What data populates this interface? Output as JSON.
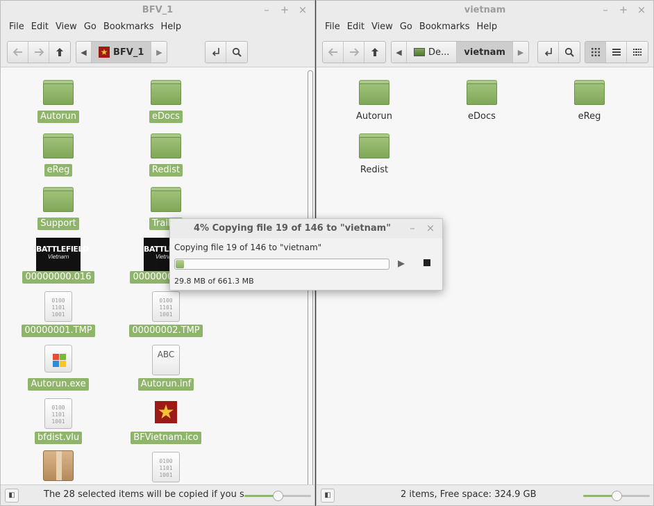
{
  "left_window": {
    "title": "BFV_1",
    "menu": [
      "File",
      "Edit",
      "View",
      "Go",
      "Bookmarks",
      "Help"
    ],
    "breadcrumb": [
      "BFV_1"
    ],
    "items": [
      {
        "name": "Autorun",
        "type": "folder"
      },
      {
        "name": "eDocs",
        "type": "folder"
      },
      {
        "name": "eReg",
        "type": "folder"
      },
      {
        "name": "Redist",
        "type": "folder"
      },
      {
        "name": "Support",
        "type": "folder"
      },
      {
        "name": "Trailer",
        "type": "folder"
      },
      {
        "name": "00000000.016",
        "type": "battlefield-image"
      },
      {
        "name": "00000001.016",
        "type": "battlefield-image"
      },
      {
        "name": "00000001.TMP",
        "type": "binary"
      },
      {
        "name": "00000002.TMP",
        "type": "binary"
      },
      {
        "name": "Autorun.exe",
        "type": "windows-exe"
      },
      {
        "name": "Autorun.inf",
        "type": "text"
      },
      {
        "name": "bfdist.vlu",
        "type": "binary"
      },
      {
        "name": "BFVietnam.ico",
        "type": "ico"
      },
      {
        "name": "",
        "type": "package"
      },
      {
        "name": "",
        "type": "binary"
      }
    ],
    "binary_glyph": [
      "0100",
      "1101",
      "1001"
    ],
    "text_glyph": "ABC",
    "bf_logo": {
      "main": "BATTLEFIELD",
      "sub": "Vietnam"
    },
    "status": "The 28 selected items will be copied if you s...",
    "zoom_level": 0.5
  },
  "right_window": {
    "title": "vietnam",
    "menu": [
      "File",
      "Edit",
      "View",
      "Go",
      "Bookmarks",
      "Help"
    ],
    "breadcrumb": [
      "De...",
      "vietnam"
    ],
    "items": [
      {
        "name": "Autorun",
        "type": "folder"
      },
      {
        "name": "eDocs",
        "type": "folder"
      },
      {
        "name": "eReg",
        "type": "folder"
      },
      {
        "name": "Redist",
        "type": "folder"
      }
    ],
    "status": "2 items, Free space: 324.9 GB",
    "zoom_level": 0.5
  },
  "dialog": {
    "title": "4% Copying file 19 of 146 to \"vietnam\"",
    "message": "Copying file 19 of 146 to \"vietnam\"",
    "progress": 0.04,
    "size_text": "29.8 MB of 661.3 MB"
  },
  "colors": {
    "accent": "#8fb56a",
    "folder": "#8db566",
    "titlebar": "#ebebeb"
  },
  "icons": {
    "back": "arrow-left-icon",
    "forward": "arrow-right-icon",
    "up": "arrow-up-icon",
    "toggle_location": "location-icon",
    "search": "search-icon",
    "icon_view": "grid-icon",
    "list_view": "list-icon",
    "compact_view": "compact-icon"
  }
}
